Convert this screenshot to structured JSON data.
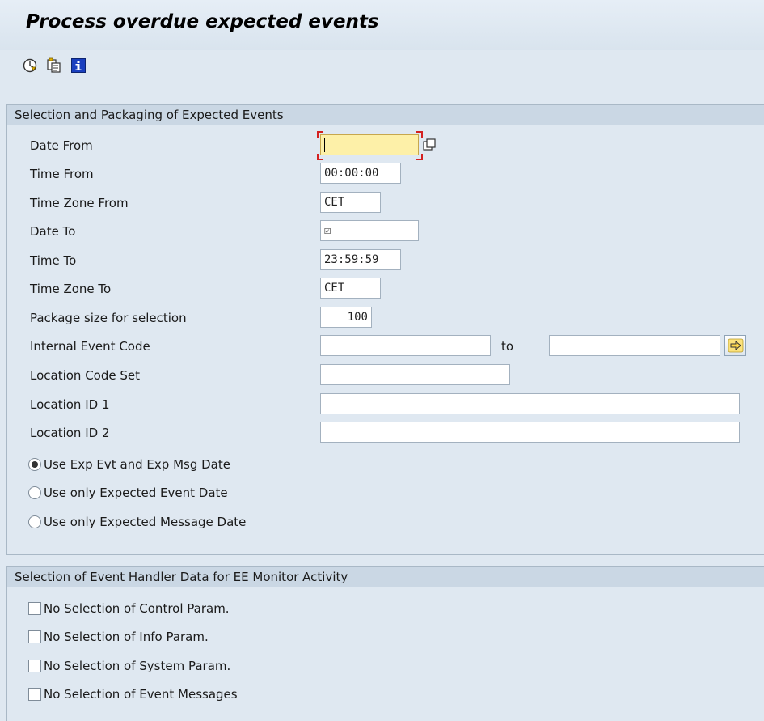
{
  "window": {
    "title": "Process overdue expected events"
  },
  "toolbar": {
    "icons": [
      "execute-icon",
      "copy-variant-icon",
      "info-icon"
    ]
  },
  "section1": {
    "header": "Selection and Packaging of Expected Events",
    "fields": {
      "date_from": {
        "label": "Date From",
        "value": ""
      },
      "time_from": {
        "label": "Time From",
        "value": "00:00:00"
      },
      "tz_from": {
        "label": "Time Zone From",
        "value": "CET"
      },
      "date_to": {
        "label": "Date To",
        "value": "☑"
      },
      "time_to": {
        "label": "Time To",
        "value": "23:59:59"
      },
      "tz_to": {
        "label": "Time Zone To",
        "value": "CET"
      },
      "package_size": {
        "label": "Package size for selection",
        "value": "100"
      },
      "internal_event_code": {
        "label": "Internal Event Code",
        "from": "",
        "to_label": "to",
        "to": ""
      },
      "location_code_set": {
        "label": "Location Code Set",
        "value": ""
      },
      "location_id1": {
        "label": "Location ID 1",
        "value": ""
      },
      "location_id2": {
        "label": "Location ID 2",
        "value": ""
      }
    },
    "radios": [
      {
        "label": "Use Exp Evt and Exp Msg Date",
        "selected": true
      },
      {
        "label": "Use only Expected Event Date",
        "selected": false
      },
      {
        "label": "Use only Expected Message Date",
        "selected": false
      }
    ]
  },
  "section2": {
    "header": "Selection of Event Handler Data for EE Monitor Activity",
    "checkboxes": [
      {
        "label": "No Selection of Control Param.",
        "checked": false
      },
      {
        "label": "No Selection of Info Param.",
        "checked": false
      },
      {
        "label": "No Selection of System Param.",
        "checked": false
      },
      {
        "label": "No Selection of Event Messages",
        "checked": false
      }
    ]
  },
  "colors": {
    "background": "#dfe8f1",
    "section_header": "#cad7e4",
    "required_field": "#fdf0a8",
    "required_marker": "#d42020"
  }
}
